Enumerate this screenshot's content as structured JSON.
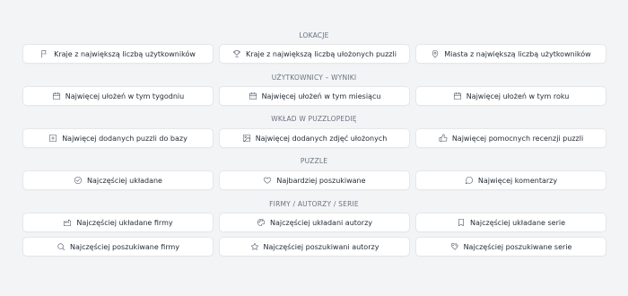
{
  "sections": [
    {
      "title": "LOKACJE",
      "rows": [
        [
          {
            "label": "Kraje z największą liczbą użytkowników",
            "icon": "flag-icon"
          },
          {
            "label": "Kraje z największą liczbą ułożonych puzzli",
            "icon": "trophy-icon"
          },
          {
            "label": "Miasta z największą liczbą użytkowników",
            "icon": "map-pin-icon"
          }
        ]
      ]
    },
    {
      "title": "UŻYTKOWNICY – WYNIKI",
      "rows": [
        [
          {
            "label": "Najwięcej ułożeń w tym tygodniu",
            "icon": "calendar-icon"
          },
          {
            "label": "Najwięcej ułożeń w tym miesiącu",
            "icon": "calendar-grid-icon"
          },
          {
            "label": "Najwięcej ułożeń w tym roku",
            "icon": "calendar-icon"
          }
        ]
      ]
    },
    {
      "title": "WKŁAD W PUZZLOPEDIĘ",
      "rows": [
        [
          {
            "label": "Najwięcej dodanych puzzli do bazy",
            "icon": "square-plus-icon"
          },
          {
            "label": "Najwięcej dodanych zdjęć ułożonych",
            "icon": "image-icon"
          },
          {
            "label": "Najwięcej pomocnych recenzji puzzli",
            "icon": "thumbs-up-icon"
          }
        ]
      ]
    },
    {
      "title": "PUZZLE",
      "rows": [
        [
          {
            "label": "Najczęściej układane",
            "icon": "check-circle-icon"
          },
          {
            "label": "Najbardziej poszukiwane",
            "icon": "heart-icon"
          },
          {
            "label": "Najwięcej komentarzy",
            "icon": "message-circle-icon"
          }
        ]
      ]
    },
    {
      "title": "FIRMY / AUTORZY / SERIE",
      "rows": [
        [
          {
            "label": "Najczęściej układane firmy",
            "icon": "factory-icon"
          },
          {
            "label": "Najczęściej układani autorzy",
            "icon": "palette-icon"
          },
          {
            "label": "Najczęściej układane serie",
            "icon": "bookmark-icon"
          }
        ],
        [
          {
            "label": "Najczęściej poszukiwane firmy",
            "icon": "search-icon"
          },
          {
            "label": "Najczęściej poszukiwani autorzy",
            "icon": "star-icon"
          },
          {
            "label": "Najczęściej poszukiwane serie",
            "icon": "tags-icon"
          }
        ]
      ]
    }
  ]
}
